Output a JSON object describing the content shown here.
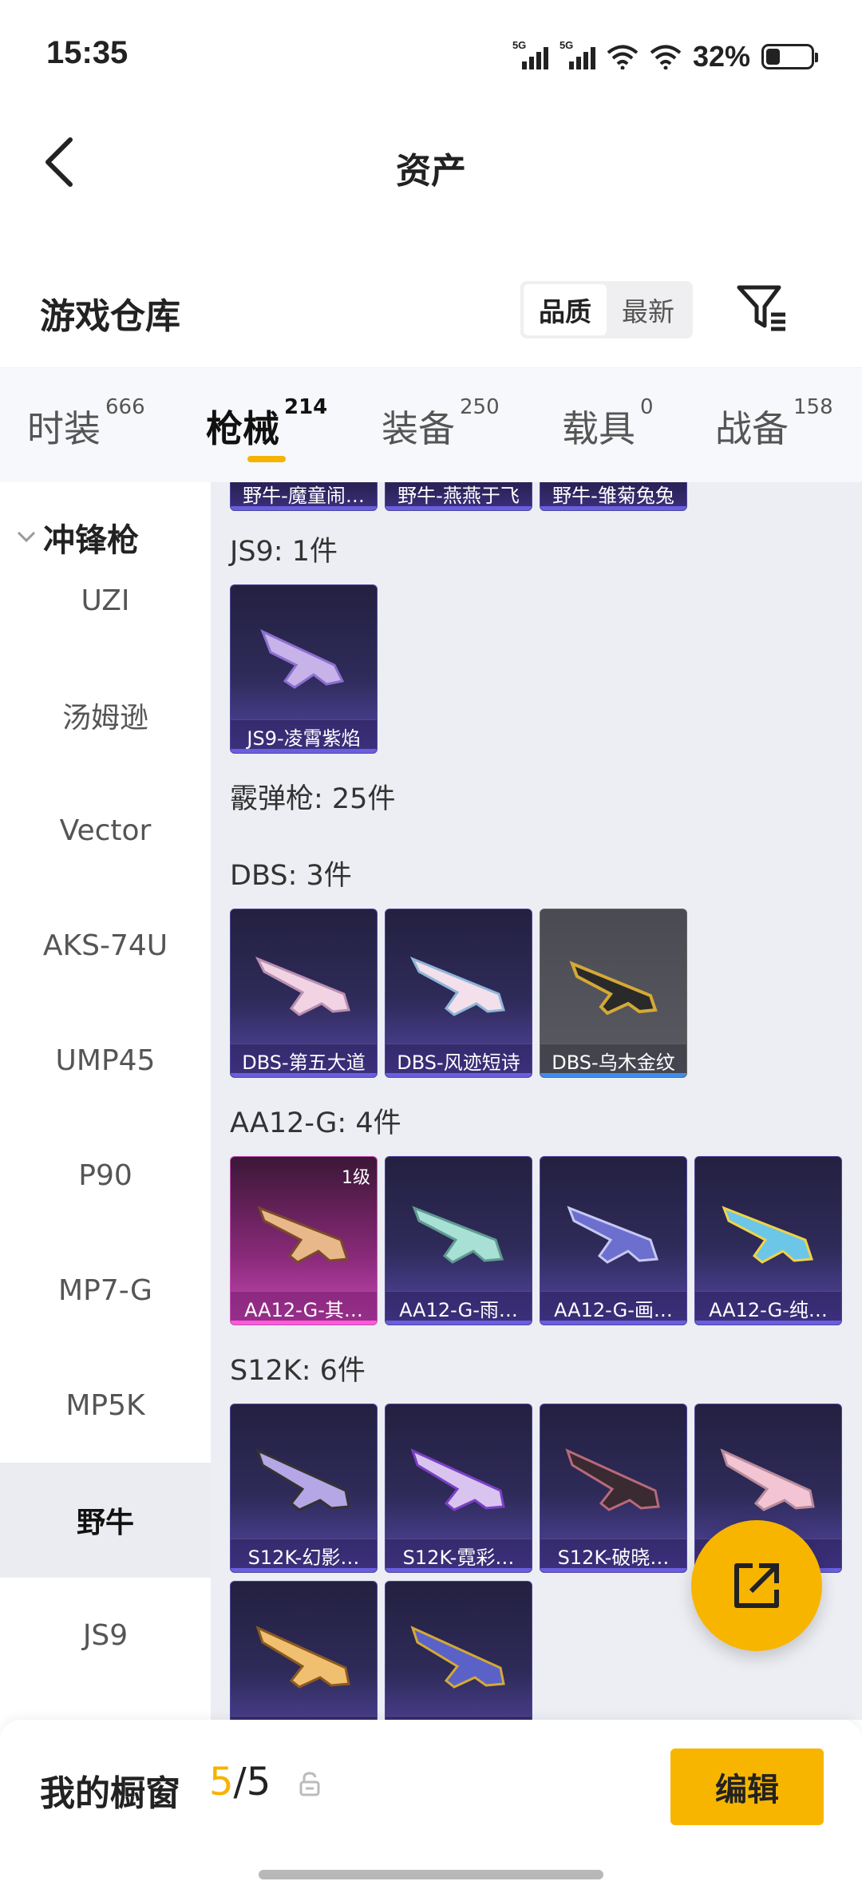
{
  "status": {
    "time": "15:35",
    "signal1": "5G",
    "signal2": "5G",
    "battery": "32%",
    "battery_level": 0.32
  },
  "header": {
    "title": "资产"
  },
  "warehouse": {
    "title": "游戏仓库",
    "sort_options": [
      "品质",
      "最新"
    ],
    "active_sort": 0
  },
  "tabs": [
    {
      "label": "时装",
      "count": "666"
    },
    {
      "label": "枪械",
      "count": "214"
    },
    {
      "label": "装备",
      "count": "250"
    },
    {
      "label": "载具",
      "count": "0"
    },
    {
      "label": "战备",
      "count": "158"
    }
  ],
  "active_tab": 1,
  "sidebar": {
    "group": "冲锋枪",
    "items": [
      "UZI",
      "汤姆逊",
      "Vector",
      "AKS-74U",
      "UMP45",
      "P90",
      "MP7-G",
      "MP5K",
      "野牛",
      "JS9"
    ],
    "active_index": 8
  },
  "content": {
    "partial_cards": [
      "野牛-魔童闹…",
      "野牛-燕燕于飞",
      "野牛-雏菊兔兔"
    ],
    "sections": [
      {
        "title": "JS9: 1件",
        "cards": [
          {
            "name": "JS9-凌霄紫焰",
            "style": "purple"
          }
        ]
      },
      {
        "title": "霰弹枪: 25件",
        "cards": []
      },
      {
        "title": "DBS: 3件",
        "cards": [
          {
            "name": "DBS-第五大道",
            "style": "purple"
          },
          {
            "name": "DBS-风迹短诗",
            "style": "purple"
          },
          {
            "name": "DBS-乌木金纹",
            "style": "gray"
          }
        ]
      },
      {
        "title": "AA12-G: 4件",
        "cards": [
          {
            "name": "AA12-G-其…",
            "style": "pink",
            "level": "1级"
          },
          {
            "name": "AA12-G-雨…",
            "style": "purple"
          },
          {
            "name": "AA12-G-画…",
            "style": "purple"
          },
          {
            "name": "AA12-G-纯…",
            "style": "purple"
          }
        ]
      },
      {
        "title": "S12K: 6件",
        "cards": [
          {
            "name": "S12K-幻影…",
            "style": "purple"
          },
          {
            "name": "S12K-霓彩…",
            "style": "purple"
          },
          {
            "name": "S12K-破晓…",
            "style": "purple"
          },
          {
            "name": "…",
            "style": "purple"
          },
          {
            "name": "",
            "style": "purple"
          },
          {
            "name": "",
            "style": "purple"
          }
        ]
      }
    ]
  },
  "bottom": {
    "label": "我的橱窗",
    "current": "5",
    "separator": "/",
    "total": "5",
    "edit_label": "编辑"
  },
  "icons": {
    "back": "chevron-left-icon",
    "filter": "filter-icon",
    "share": "share-external-icon",
    "lock": "unlock-icon"
  },
  "colors": {
    "accent": "#F7B500",
    "card_purple": "#4E46A0",
    "card_pink": "#C84AB8",
    "card_gray": "#5A5B62"
  }
}
